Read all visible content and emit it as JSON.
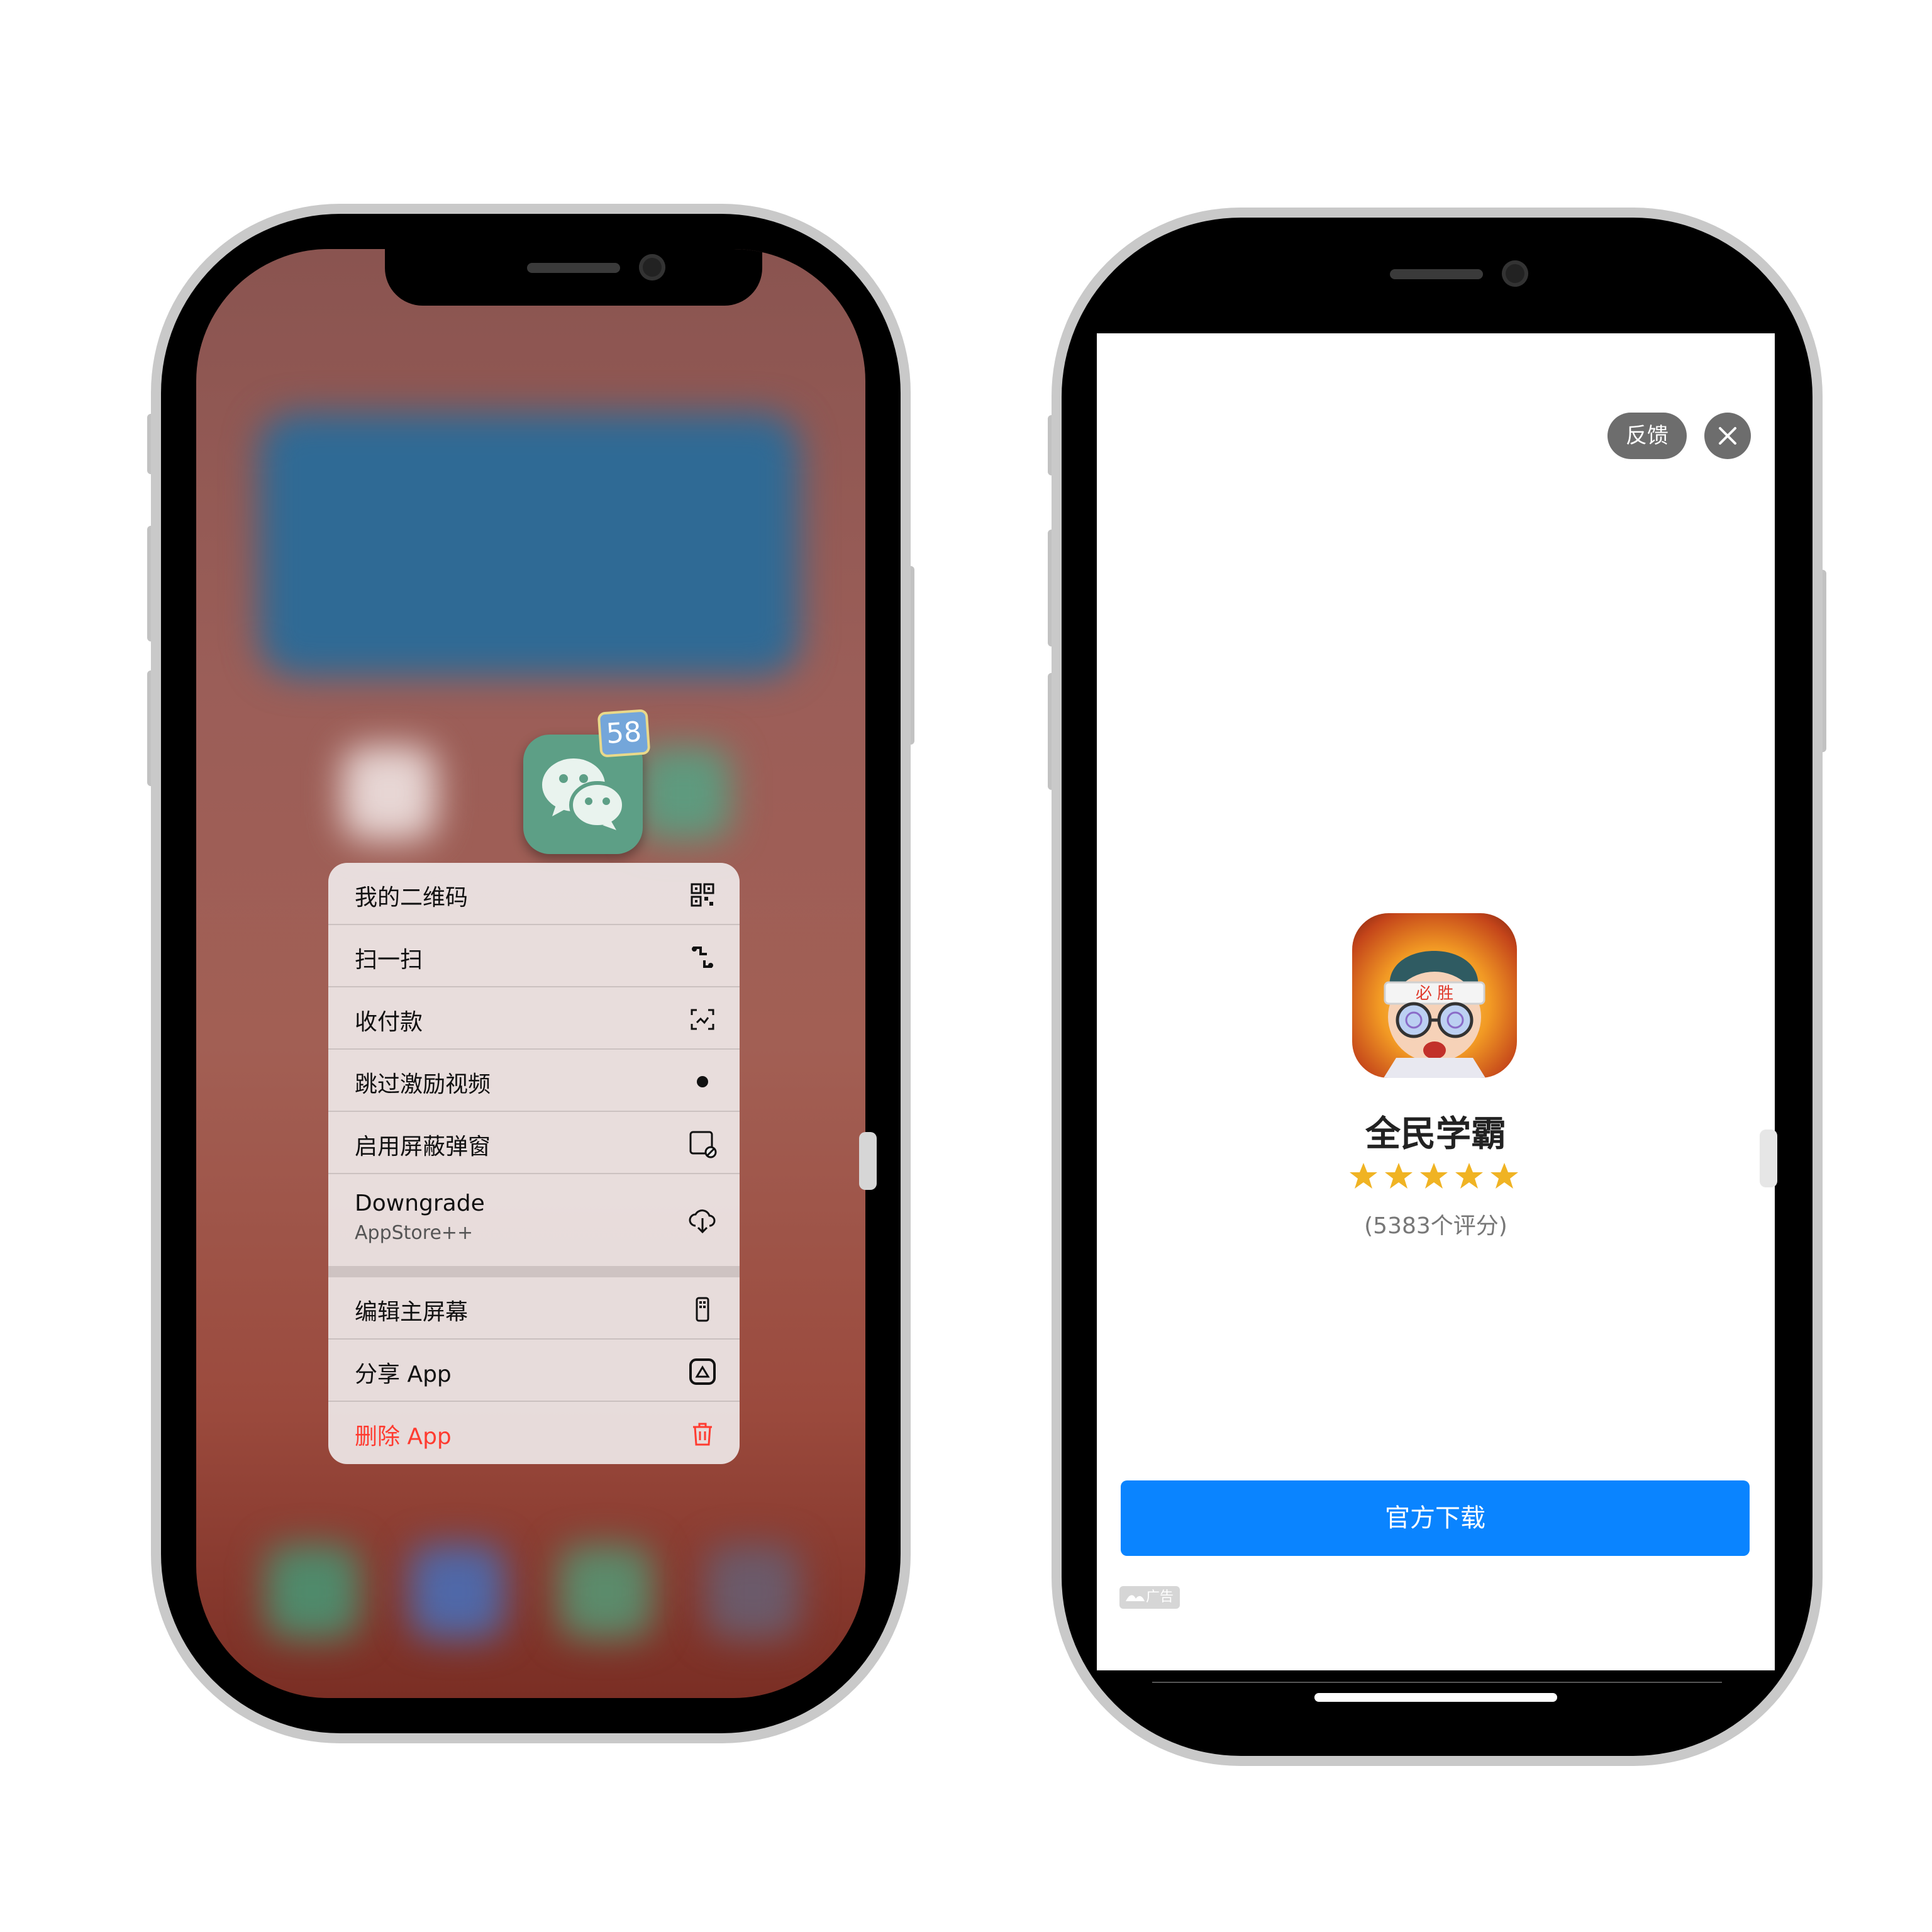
{
  "left_phone": {
    "app_badge_count": "58",
    "menu": {
      "items": [
        {
          "label": "我的二维码",
          "icon": "qr-code-icon"
        },
        {
          "label": "扫一扫",
          "icon": "scan-icon"
        },
        {
          "label": "收付款",
          "icon": "payment-frame-icon"
        },
        {
          "label": "跳过激励视频",
          "icon": "dot-icon"
        },
        {
          "label": "启用屏蔽弹窗",
          "icon": "block-popup-icon"
        },
        {
          "label": "Downgrade",
          "sublabel": "AppStore++",
          "icon": "cloud-download-icon"
        },
        {
          "label": "编辑主屏幕",
          "icon": "phone-edit-icon"
        },
        {
          "label": "分享 App",
          "icon": "share-app-icon"
        },
        {
          "label": "删除 App",
          "icon": "trash-icon"
        }
      ],
      "delete_color": "#ff3b30"
    }
  },
  "right_phone": {
    "feedback_label": "反馈",
    "close_icon": "close-icon",
    "app_name": "全民学霸",
    "app_icon_text": "必 胜",
    "stars": 5,
    "rating_text": "(5383个评分)",
    "download_label": "官方下载",
    "ad_label": "广告",
    "accent_color": "#0a84ff",
    "star_color": "#f0b323"
  }
}
